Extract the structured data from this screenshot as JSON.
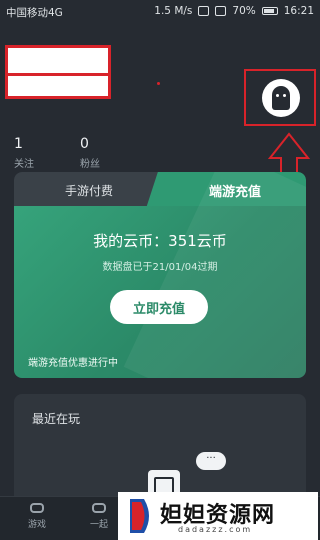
{
  "status_bar": {
    "carrier": "中国移动4G",
    "speed": "1.5 M/s",
    "battery": "70%",
    "time": "16:21"
  },
  "stats": {
    "follow_count": "1",
    "follow_label": "关注",
    "fans_count": "0",
    "fans_label": "粉丝"
  },
  "pay_card": {
    "tab_mobile": "手游付费",
    "tab_pc": "端游充值",
    "balance": "我的云币：351云币",
    "expiry": "数据盘已于21/01/04过期",
    "recharge_button": "立即充值",
    "promo": "端游充值优惠进行中"
  },
  "recent": {
    "title": "最近在玩",
    "bubble": "···"
  },
  "bottom_nav": {
    "items": [
      {
        "label": "游戏"
      },
      {
        "label": "一起"
      }
    ]
  },
  "watermark": {
    "text": "妲妲资源网",
    "url": "dadazzz.com"
  },
  "colors": {
    "accent_green": "#2f9a73",
    "annotation_red": "#d8232a",
    "background": "#262b32"
  }
}
